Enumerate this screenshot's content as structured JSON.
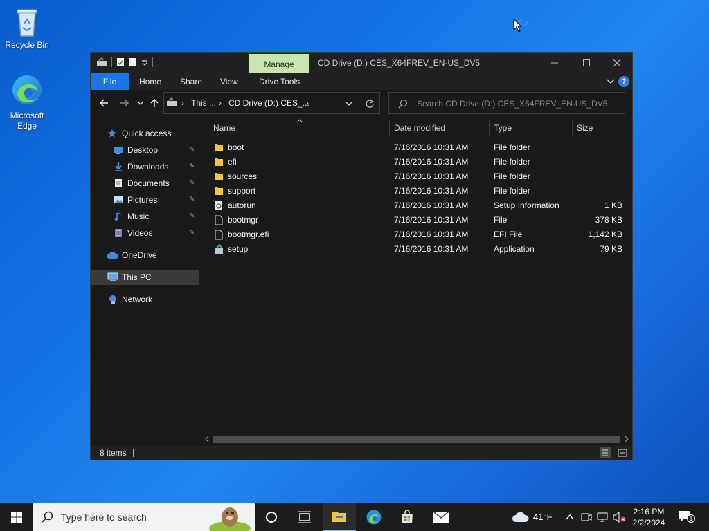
{
  "desktop": {
    "icons": [
      {
        "label": "Recycle Bin",
        "icon": "recycle-bin-icon"
      },
      {
        "label": "Microsoft Edge",
        "icon": "edge-icon"
      }
    ]
  },
  "window": {
    "title": "CD Drive (D:) CES_X64FREV_EN-US_DV5",
    "context_tab": "Manage",
    "ribbon_tabs": [
      "File",
      "Home",
      "Share",
      "View",
      "Drive Tools"
    ],
    "help": "?",
    "address": {
      "crumbs": [
        "This ...",
        "CD Drive (D:) CES_..."
      ]
    },
    "search_placeholder": "Search CD Drive (D:) CES_X64FREV_EN-US_DV5",
    "nav": [
      {
        "label": "Quick access",
        "icon": "star-icon",
        "pinned": false,
        "level": 0
      },
      {
        "label": "Desktop",
        "icon": "desktop-icon",
        "pinned": true,
        "level": 1
      },
      {
        "label": "Downloads",
        "icon": "download-icon",
        "pinned": true,
        "level": 1
      },
      {
        "label": "Documents",
        "icon": "document-icon",
        "pinned": true,
        "level": 1
      },
      {
        "label": "Pictures",
        "icon": "pictures-icon",
        "pinned": true,
        "level": 1
      },
      {
        "label": "Music",
        "icon": "music-icon",
        "pinned": true,
        "level": 1
      },
      {
        "label": "Videos",
        "icon": "video-icon",
        "pinned": true,
        "level": 1
      },
      {
        "label": "OneDrive",
        "icon": "cloud-icon",
        "pinned": false,
        "level": 0
      },
      {
        "label": "This PC",
        "icon": "computer-icon",
        "pinned": false,
        "level": 0,
        "selected": true
      },
      {
        "label": "Network",
        "icon": "network-icon",
        "pinned": false,
        "level": 0
      }
    ],
    "columns": [
      "Name",
      "Date modified",
      "Type",
      "Size"
    ],
    "files": [
      {
        "name": "boot",
        "date": "7/16/2016 10:31 AM",
        "type": "File folder",
        "size": "",
        "icon": "folder-icon"
      },
      {
        "name": "efi",
        "date": "7/16/2016 10:31 AM",
        "type": "File folder",
        "size": "",
        "icon": "folder-icon"
      },
      {
        "name": "sources",
        "date": "7/16/2016 10:31 AM",
        "type": "File folder",
        "size": "",
        "icon": "folder-icon"
      },
      {
        "name": "support",
        "date": "7/16/2016 10:31 AM",
        "type": "File folder",
        "size": "",
        "icon": "folder-icon"
      },
      {
        "name": "autorun",
        "date": "7/16/2016 10:31 AM",
        "type": "Setup Information",
        "size": "1 KB",
        "icon": "setup-info-icon"
      },
      {
        "name": "bootmgr",
        "date": "7/16/2016 10:31 AM",
        "type": "File",
        "size": "378 KB",
        "icon": "file-icon"
      },
      {
        "name": "bootmgr.efi",
        "date": "7/16/2016 10:31 AM",
        "type": "EFI File",
        "size": "1,142 KB",
        "icon": "file-icon"
      },
      {
        "name": "setup",
        "date": "7/16/2016 10:31 AM",
        "type": "Application",
        "size": "79 KB",
        "icon": "setup-app-icon"
      }
    ],
    "status": "8 items"
  },
  "taskbar": {
    "search_placeholder": "Type here to search",
    "weather": "41°F",
    "time": "2:16 PM",
    "date": "2/2/2024",
    "notifications": "1"
  },
  "colors": {
    "accent": "#1a73e8",
    "manage_tab": "#c9e6b1",
    "folder": "#f4c542"
  }
}
